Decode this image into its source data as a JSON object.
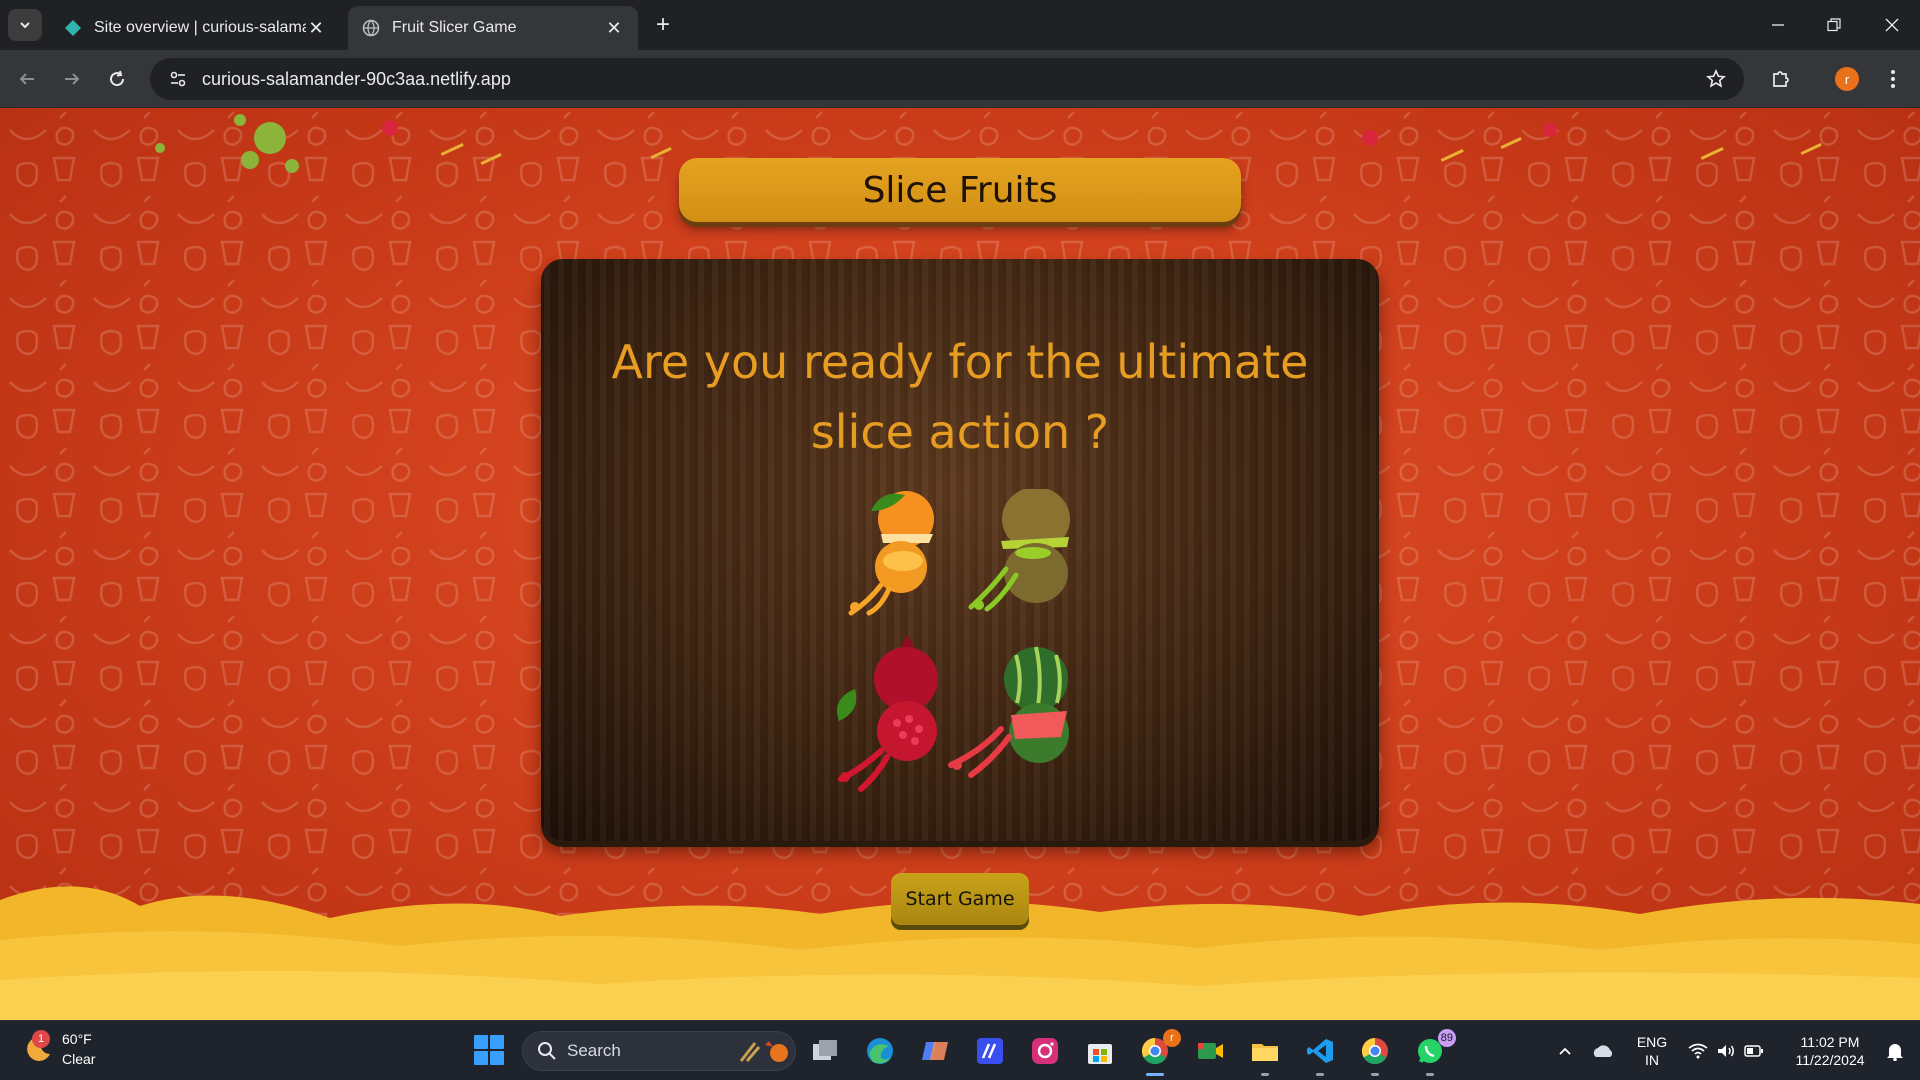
{
  "browser": {
    "tabs": [
      {
        "title": "Site overview | curious-salaman",
        "active": false
      },
      {
        "title": "Fruit Slicer Game",
        "active": true
      }
    ],
    "url": "curious-salamander-90c3aa.netlify.app",
    "profile_initial": "r"
  },
  "page": {
    "title": "Slice Fruits",
    "question": "Are you ready for the ultimate slice action ?",
    "fruits": [
      "orange",
      "kiwi",
      "pomegranate",
      "watermelon"
    ],
    "start_button": "Start Game",
    "colors": {
      "background": "#cf3f1b",
      "banner": "#e6a321",
      "question": "#e79c22",
      "button": "#c9a21a"
    }
  },
  "taskbar": {
    "weather": {
      "temp": "60°F",
      "condition": "Clear",
      "alert_count": "1"
    },
    "search_label": "Search",
    "whatsapp_badge": "89",
    "chrome_badge": "r",
    "language": {
      "line1": "ENG",
      "line2": "IN"
    },
    "clock": {
      "time": "11:02 PM",
      "date": "11/22/2024"
    }
  }
}
